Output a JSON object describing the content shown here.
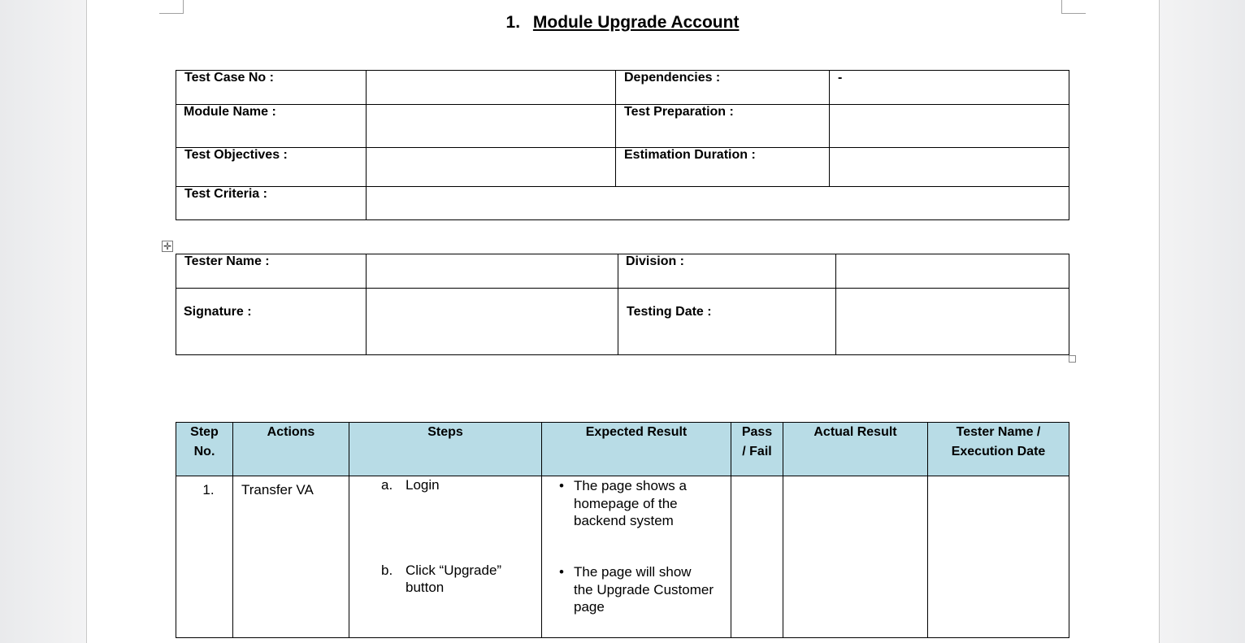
{
  "heading": {
    "number": "1.",
    "title": "Module Upgrade Account"
  },
  "info_table": {
    "test_case_no_label": "Test Case No :",
    "test_case_no_value": "",
    "dependencies_label": "Dependencies :",
    "dependencies_value": "-",
    "module_name_label": "Module Name :",
    "module_name_value": "",
    "test_preparation_label": "Test Preparation :",
    "test_preparation_value": "",
    "test_objectives_label": "Test Objectives :",
    "test_objectives_value": "",
    "estimation_duration_label": "Estimation Duration :",
    "estimation_duration_value": "",
    "test_criteria_label": "Test Criteria :",
    "test_criteria_value": ""
  },
  "tester_table": {
    "tester_name_label": "Tester Name :",
    "tester_name_value": "",
    "division_label": "Division :",
    "division_value": "",
    "signature_label": "Signature :",
    "signature_value": "",
    "testing_date_label": "Testing Date :",
    "testing_date_value": ""
  },
  "steps_table": {
    "headers": {
      "step_no_line1": "Step",
      "step_no_line2": "No.",
      "actions": "Actions",
      "steps": "Steps",
      "expected_result": "Expected Result",
      "pass_fail_line1": "Pass",
      "pass_fail_line2": "/ Fail",
      "actual_result": "Actual Result",
      "tester_line1": "Tester Name /",
      "tester_line2": "Execution Date"
    },
    "rows": [
      {
        "step_no": "1.",
        "action": "Transfer VA",
        "substeps": [
          {
            "marker": "a.",
            "line1": "Login",
            "line2": ""
          },
          {
            "marker": "b.",
            "line1": "Click “Upgrade”",
            "line2": "button"
          }
        ],
        "expected": [
          {
            "line1": "The page shows a",
            "line2": "homepage of the",
            "line3": "backend system"
          },
          {
            "line1": "The page will show",
            "line2": "the Upgrade Customer",
            "line3": "page"
          }
        ],
        "bullet_glyph": "•",
        "pass_fail": "",
        "actual_result": "",
        "tester_exec": ""
      }
    ]
  }
}
